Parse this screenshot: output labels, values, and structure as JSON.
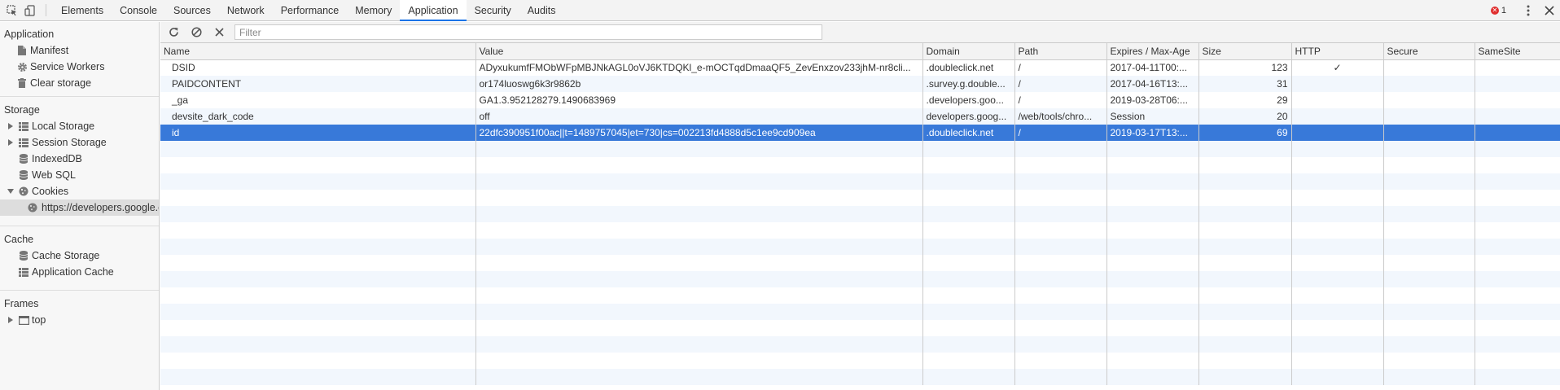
{
  "toolbar": {
    "tabs": [
      "Elements",
      "Console",
      "Sources",
      "Network",
      "Performance",
      "Memory",
      "Application",
      "Security",
      "Audits"
    ],
    "active_tab": "Application",
    "error_count": "1"
  },
  "sidebar": {
    "application": {
      "title": "Application",
      "items": [
        "Manifest",
        "Service Workers",
        "Clear storage"
      ]
    },
    "storage": {
      "title": "Storage",
      "items": [
        "Local Storage",
        "Session Storage",
        "IndexedDB",
        "Web SQL",
        "Cookies"
      ],
      "cookie_child": "https://developers.google.com"
    },
    "cache": {
      "title": "Cache",
      "items": [
        "Cache Storage",
        "Application Cache"
      ]
    },
    "frames": {
      "title": "Frames",
      "items": [
        "top"
      ]
    }
  },
  "filter": {
    "placeholder": "Filter",
    "value": ""
  },
  "table": {
    "columns": [
      "Name",
      "Value",
      "Domain",
      "Path",
      "Expires / Max-Age",
      "Size",
      "HTTP",
      "Secure",
      "SameSite"
    ],
    "rows": [
      [
        "DSID",
        "ADyxukumfFMObWFpMBJNkAGL0oVJ6KTDQKl_e-mOCTqdDmaaQF5_ZevEnxzov233jhM-nr8cli...",
        ".doubleclick.net",
        "/",
        "2017-04-11T00:...",
        "123",
        "✓",
        "",
        ""
      ],
      [
        "PAIDCONTENT",
        "or174luoswg6k3r9862b",
        ".survey.g.double...",
        "/",
        "2017-04-16T13:...",
        "31",
        "",
        "",
        ""
      ],
      [
        "_ga",
        "GA1.3.952128279.1490683969",
        ".developers.goo...",
        "/",
        "2019-03-28T06:...",
        "29",
        "",
        "",
        ""
      ],
      [
        "devsite_dark_code",
        "off",
        "developers.goog...",
        "/web/tools/chro...",
        "Session",
        "20",
        "",
        "",
        ""
      ],
      [
        "id",
        "22dfc390951f00ac||t=1489757045|et=730|cs=002213fd4888d5c1ee9cd909ea",
        ".doubleclick.net",
        "/",
        "2019-03-17T13:...",
        "69",
        "",
        "",
        ""
      ]
    ],
    "selected_row": 4,
    "empty_rows": 15
  }
}
